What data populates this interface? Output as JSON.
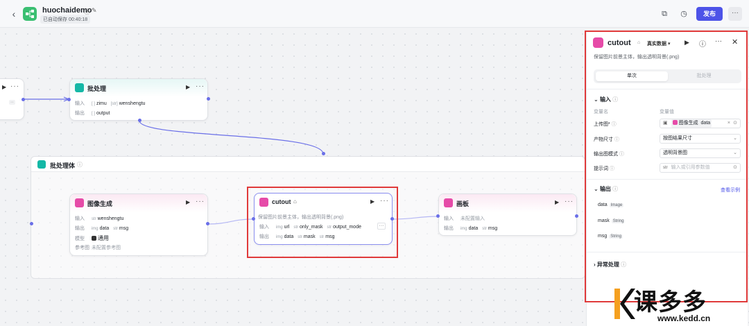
{
  "topbar": {
    "app_name": "huochaidemo",
    "autosave": "已自动保存 00:40:18",
    "publish_label": "发布",
    "more_label": "···"
  },
  "colors": {
    "accent": "#4d53e8",
    "highlight": "#e03a3a",
    "batch_icon": "#14b8a6",
    "image_icon": "#e64ba8"
  },
  "partial_node": {
    "more": "···",
    "output_var": "··"
  },
  "batch_node": {
    "title": "批处理",
    "input_label": "输入",
    "input_tags": [
      {
        "type": "[ ]",
        "name": "zimu"
      },
      {
        "type": "[str]",
        "name": "wenshengtu"
      }
    ],
    "output_label": "输出",
    "output_tags": [
      {
        "type": "[ ]",
        "name": "output"
      }
    ]
  },
  "group": {
    "title": "批处理体"
  },
  "image_gen_node": {
    "title": "图像生成",
    "input_label": "输入",
    "input_tags": [
      {
        "type": "str",
        "name": "wenshengtu"
      }
    ],
    "output_label": "输出",
    "output_tags": [
      {
        "type": "img",
        "name": "data"
      },
      {
        "type": "str",
        "name": "msg"
      }
    ],
    "model_label": "模型",
    "model_value": "通用",
    "ref_label": "参考图",
    "ref_value": "未配置参考图"
  },
  "cutout_node": {
    "title": "cutout",
    "desc": "保留图片前景主体，输出透明背景(.png)",
    "input_label": "输入",
    "input_tags": [
      {
        "type": "img",
        "name": "url"
      },
      {
        "type": "str",
        "name": "only_mask"
      },
      {
        "type": "str",
        "name": "output_mode"
      }
    ],
    "output_label": "输出",
    "output_tags": [
      {
        "type": "img",
        "name": "data"
      },
      {
        "type": "str",
        "name": "mask"
      },
      {
        "type": "str",
        "name": "msg"
      }
    ]
  },
  "canvas_node": {
    "title": "画板",
    "input_label": "输入",
    "input_value": "未配置输入",
    "output_label": "输出",
    "output_tags": [
      {
        "type": "img",
        "name": "data"
      },
      {
        "type": "str",
        "name": "msg"
      }
    ]
  },
  "panel": {
    "title": "cutout",
    "data_mode": "真实数据",
    "desc": "保留图片前景主体，输出透明背景(.png)",
    "tabs": [
      "单次",
      "批处理"
    ],
    "input_section": "输入",
    "col_var_name": "变量名",
    "col_var_value": "变量值",
    "params": [
      {
        "label": "上传图*",
        "value": "图像生成",
        "value2": "data"
      },
      {
        "label": "产物尺寸",
        "value": "按图结果尺寸"
      },
      {
        "label": "输出图模式",
        "value": "透明背景图"
      },
      {
        "label": "提示词",
        "type": "str",
        "value": "输入或引用参数值"
      }
    ],
    "output_section": "输出",
    "see_example": "查看示例",
    "outputs": [
      {
        "name": "data",
        "type": "Image"
      },
      {
        "name": "mask",
        "type": "String"
      },
      {
        "name": "msg",
        "type": "String"
      }
    ],
    "exception_section": "异常处理"
  },
  "watermark": {
    "text": "课多多",
    "url": "www.kedd.cn"
  }
}
